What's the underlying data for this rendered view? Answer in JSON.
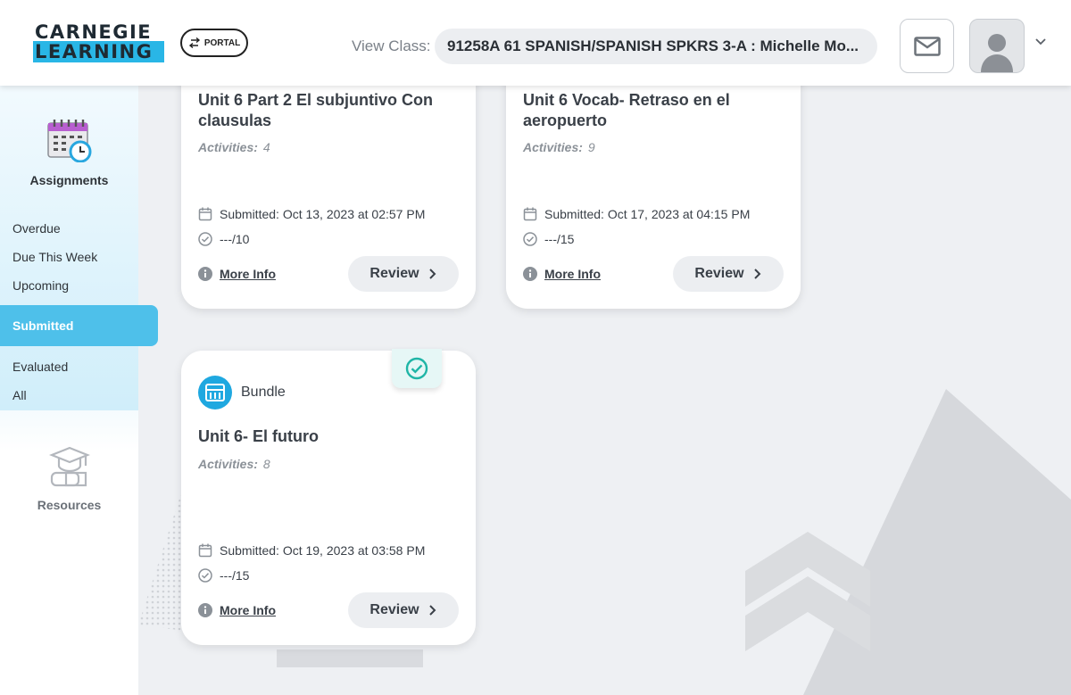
{
  "brand": {
    "line1": "CARNEGIE",
    "line2": "LEARNING"
  },
  "header": {
    "portal_label": "PORTAL",
    "view_class_label": "View Class:",
    "class_value": "91258A 61 SPANISH/SPANISH SPKRS 3-A : Michelle Mo..."
  },
  "sidebar": {
    "assignments_label": "Assignments",
    "items": [
      "Overdue",
      "Due This Week",
      "Upcoming",
      "Submitted",
      "Evaluated",
      "All"
    ],
    "resources_label": "Resources"
  },
  "cards": [
    {
      "title": "Unit 6 Part 2 El subjuntivo Con clausulas",
      "activities_label": "Activities:",
      "activities": "4",
      "submitted": "Submitted: Oct 13, 2023 at 02:57 PM",
      "score": "---/10",
      "more_info": "More Info",
      "review": "Review"
    },
    {
      "title": "Unit 6 Vocab- Retraso en el aeropuerto",
      "activities_label": "Activities:",
      "activities": "9",
      "submitted": "Submitted: Oct 17, 2023 at 04:15 PM",
      "score": "---/15",
      "more_info": "More Info",
      "review": "Review"
    },
    {
      "type_label": "Bundle",
      "title": "Unit 6- El futuro",
      "activities_label": "Activities:",
      "activities": "8",
      "submitted": "Submitted: Oct 19, 2023 at 03:58 PM",
      "score": "---/15",
      "more_info": "More Info",
      "review": "Review"
    }
  ],
  "colors": {
    "accent": "#4ec0ea",
    "brand_blue": "#29b6e6",
    "check": "#1fb5a6"
  }
}
